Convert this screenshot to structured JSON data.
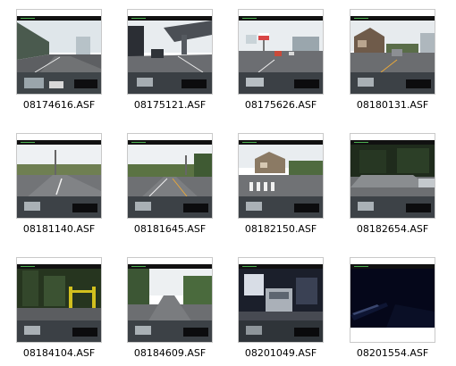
{
  "files": [
    {
      "name": "08174616.ASF",
      "scene": "highway-wall"
    },
    {
      "name": "08175121.ASF",
      "scene": "overpass"
    },
    {
      "name": "08175626.ASF",
      "scene": "city-road-sign"
    },
    {
      "name": "08180131.ASF",
      "scene": "town-street"
    },
    {
      "name": "08181140.ASF",
      "scene": "rural-road-crossing"
    },
    {
      "name": "08181645.ASF",
      "scene": "country-road"
    },
    {
      "name": "08182150.ASF",
      "scene": "crosswalk-houses"
    },
    {
      "name": "08182654.ASF",
      "scene": "forest-parking"
    },
    {
      "name": "08184104.ASF",
      "scene": "forest-yellow-gate"
    },
    {
      "name": "08184609.ASF",
      "scene": "mountain-road"
    },
    {
      "name": "08201049.ASF",
      "scene": "night-van"
    },
    {
      "name": "08201554.ASF",
      "scene": "night-dark-road"
    }
  ],
  "colors": {
    "frame_border": "#c9c9c9",
    "label_text": "#000000",
    "background": "#ffffff"
  }
}
